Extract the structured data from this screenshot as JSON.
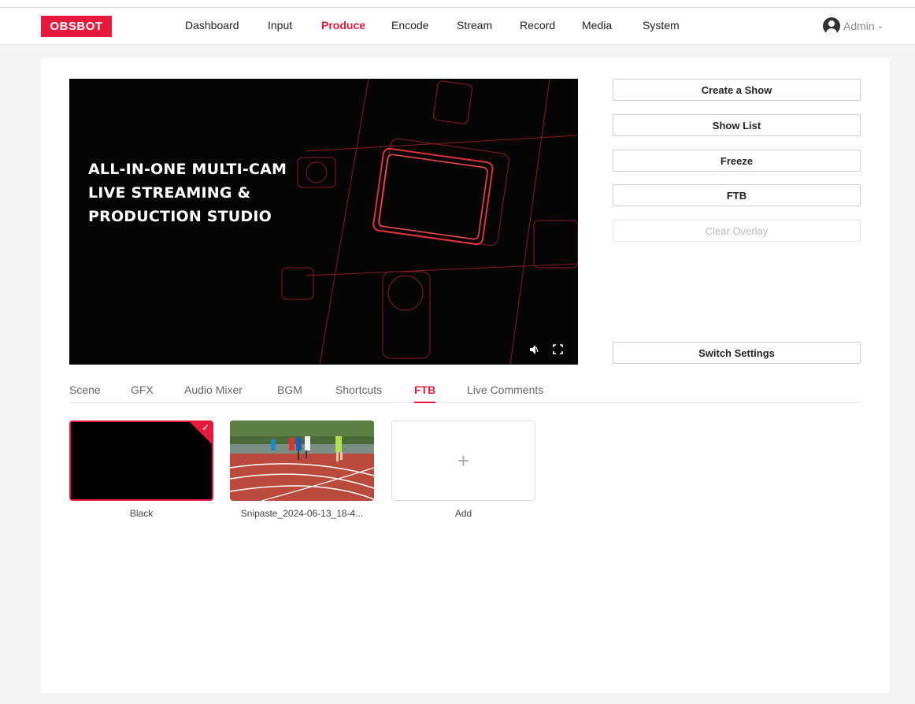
{
  "header": {
    "logo": "OBSBOT",
    "nav": [
      {
        "label": "Dashboard",
        "active": false
      },
      {
        "label": "Input",
        "active": false
      },
      {
        "label": "Produce",
        "active": true
      },
      {
        "label": "Encode",
        "active": false
      },
      {
        "label": "Stream",
        "active": false
      },
      {
        "label": "Record",
        "active": false
      },
      {
        "label": "Media",
        "active": false
      },
      {
        "label": "System",
        "active": false
      }
    ],
    "user": "Admin"
  },
  "preview": {
    "title_lines": [
      "ALL-IN-ONE MULTI-CAM",
      "LIVE STREAMING &",
      "PRODUCTION STUDIO"
    ]
  },
  "actions": {
    "create_show": "Create a Show",
    "show_list": "Show List",
    "freeze": "Freeze",
    "ftb": "FTB",
    "clear_overlay": "Clear Overlay",
    "switch_settings": "Switch Settings"
  },
  "tabs": [
    {
      "label": "Scene",
      "active": false
    },
    {
      "label": "GFX",
      "active": false
    },
    {
      "label": "Audio Mixer",
      "active": false
    },
    {
      "label": "BGM",
      "active": false
    },
    {
      "label": "Shortcuts",
      "active": false
    },
    {
      "label": "FTB",
      "active": true
    },
    {
      "label": "Live Comments",
      "active": false
    }
  ],
  "ftb_items": [
    {
      "label": "Black",
      "selected": true
    },
    {
      "label": "Snipaste_2024-06-13_18-4...",
      "selected": false
    },
    {
      "label": "Add",
      "selected": false
    }
  ],
  "colors": {
    "accent": "#e8193c"
  }
}
